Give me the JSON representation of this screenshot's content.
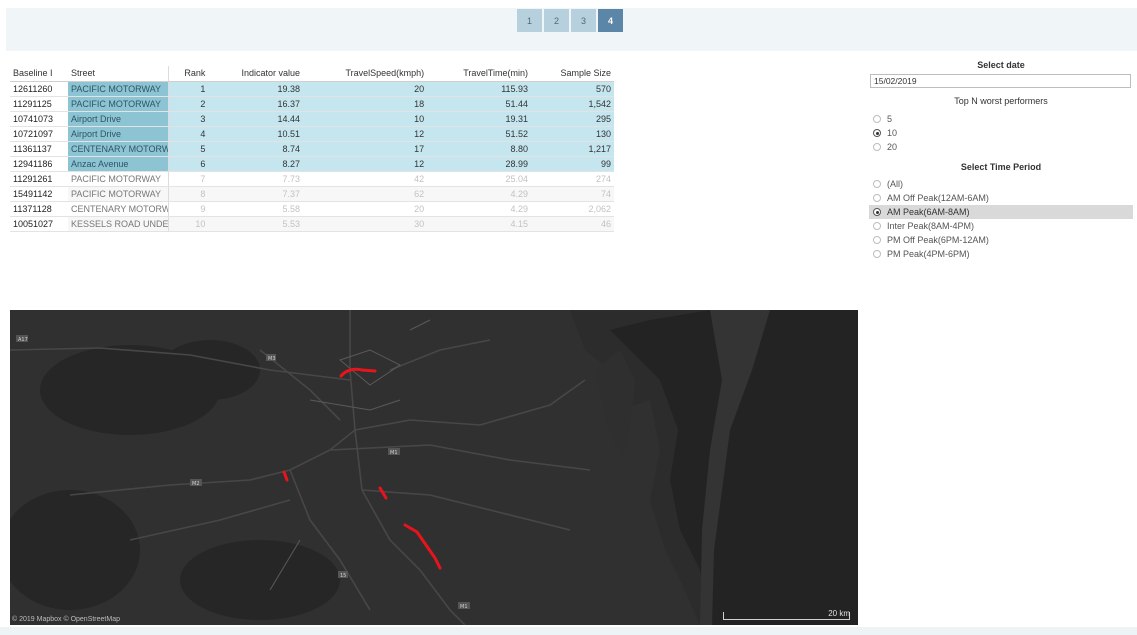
{
  "pager": [
    "1",
    "2",
    "3",
    "4"
  ],
  "pager_active": 3,
  "table": {
    "headers": [
      "Baseline I",
      "Street",
      "Rank",
      "Indicator value",
      "TravelSpeed(kmph)",
      "TravelTime(min)",
      "Sample Size"
    ],
    "highlight_count": 6,
    "rows": [
      [
        "12611260",
        "PACIFIC MOTORWAY",
        "1",
        "19.38",
        "20",
        "115.93",
        "570"
      ],
      [
        "11291125",
        "PACIFIC MOTORWAY",
        "2",
        "16.37",
        "18",
        "51.44",
        "1,542"
      ],
      [
        "10741073",
        "Airport Drive",
        "3",
        "14.44",
        "10",
        "19.31",
        "295"
      ],
      [
        "10721097",
        "Airport Drive",
        "4",
        "10.51",
        "12",
        "51.52",
        "130"
      ],
      [
        "11361137",
        "CENTENARY MOTORW...",
        "5",
        "8.74",
        "17",
        "8.80",
        "1,217"
      ],
      [
        "12941186",
        "Anzac Avenue",
        "6",
        "8.27",
        "12",
        "28.99",
        "99"
      ],
      [
        "11291261",
        "PACIFIC MOTORWAY",
        "7",
        "7.73",
        "42",
        "25.04",
        "274"
      ],
      [
        "15491142",
        "PACIFIC MOTORWAY",
        "8",
        "7.37",
        "62",
        "4.29",
        "74"
      ],
      [
        "11371128",
        "CENTENARY MOTORW...",
        "9",
        "5.58",
        "20",
        "4.29",
        "2,062"
      ],
      [
        "10051027",
        "KESSELS ROAD UNDE...",
        "10",
        "5.53",
        "30",
        "4.15",
        "46"
      ]
    ]
  },
  "filters": {
    "date_title": "Select date",
    "date_value": "15/02/2019",
    "topn_title": "Top N worst performers",
    "topn_options": [
      "5",
      "10",
      "20"
    ],
    "topn_selected": 1,
    "time_title": "Select Time Period",
    "time_options": [
      "(All)",
      "AM Off Peak(12AM-6AM)",
      "AM Peak(6AM-8AM)",
      "Inter Peak(8AM-4PM)",
      "PM Off Peak(6PM-12AM)",
      "PM Peak(4PM-6PM)"
    ],
    "time_selected": 2
  },
  "map": {
    "attribution": "© 2019 Mapbox © OpenStreetMap",
    "scale_label": "20 km",
    "road_labels": [
      "A17",
      "M3",
      "M1",
      "M2",
      "15",
      "M1"
    ],
    "colors": {
      "background": "#2a2a2b",
      "land": "#333334",
      "water": "#1f1f20",
      "highlight": "#e8141c"
    }
  }
}
